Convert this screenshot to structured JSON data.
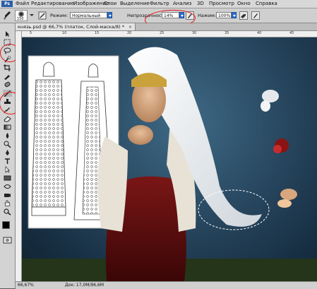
{
  "menu": {
    "app_logo": "Ps",
    "items": [
      "Файл",
      "Редактирование",
      "Изображение",
      "Слои",
      "Выделение",
      "Фильтр",
      "Анализ",
      "3D",
      "Просмотр",
      "Окно",
      "Справка"
    ]
  },
  "options": {
    "brush_size": "150",
    "mode_label": "Режим:",
    "mode_value": "Нормальный",
    "opacity_label": "Непрозрачность:",
    "opacity_value": "14%",
    "flow_label": "Нажим:",
    "flow_value": "100%"
  },
  "document": {
    "tab_title": "князь.psd @ 66,7% (платок, Слой-маска/8) *",
    "ruler_numbers": [
      "5",
      "10",
      "15",
      "20",
      "25",
      "30",
      "35",
      "40",
      "45"
    ]
  },
  "status": {
    "zoom": "66,67%",
    "doc_size": "Док: 17,0М/96,6М"
  },
  "colors": {
    "annotation": "#e01919",
    "accent": "#2f6fd0"
  }
}
